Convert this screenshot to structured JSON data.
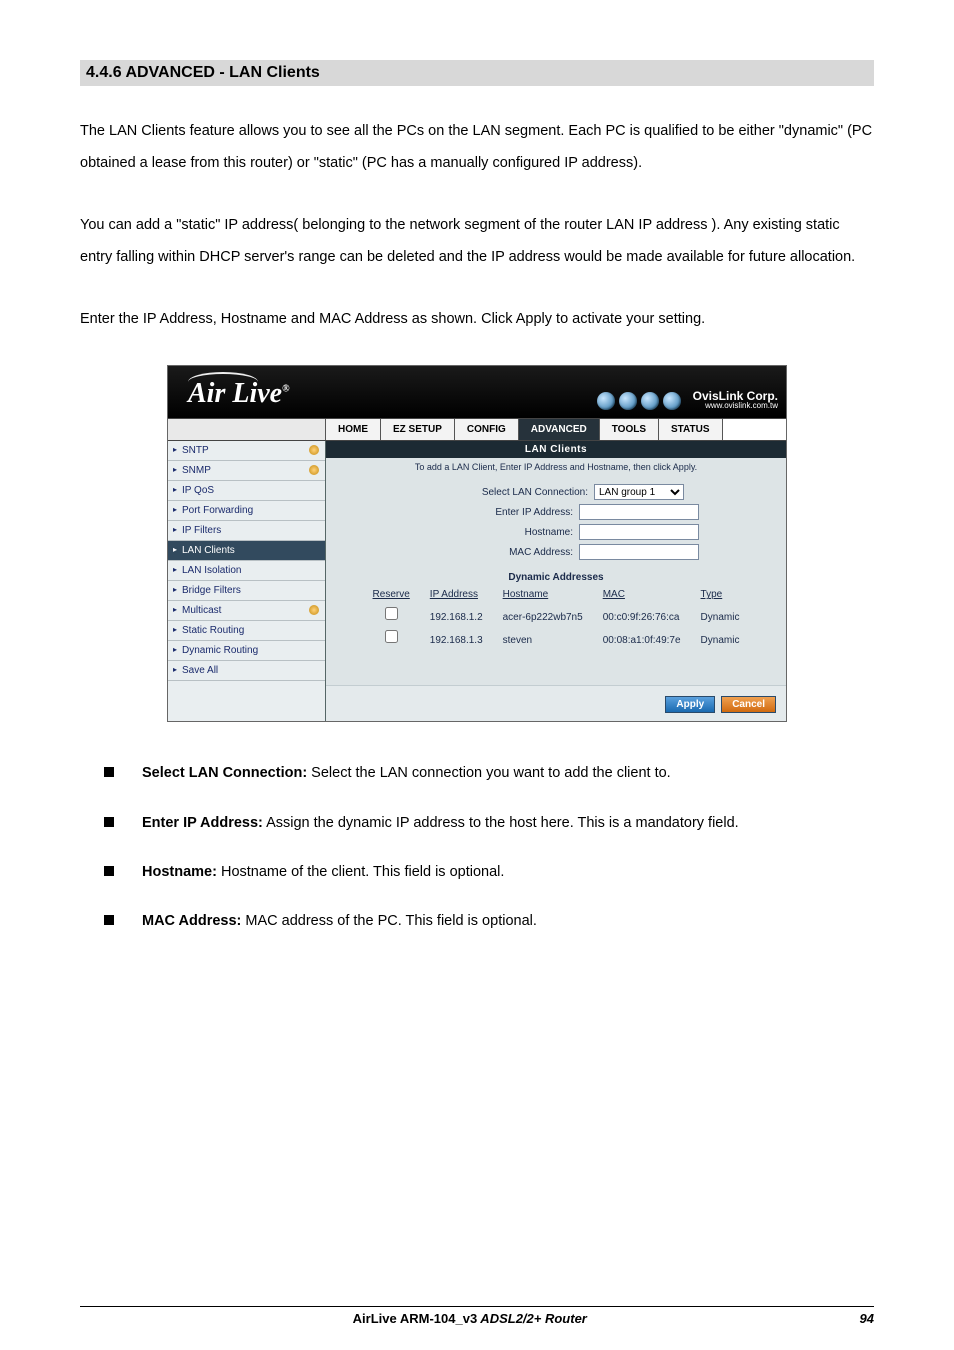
{
  "section_title": "4.4.6 ADVANCED - LAN Clients",
  "para1": "The LAN Clients feature allows you to see all the PCs on the LAN segment. Each PC is qualified to be either \"dynamic\" (PC obtained a lease from this router) or \"static\" (PC has a manually configured IP address).",
  "para2": "You can add a \"static\" IP address( belonging to the network segment of the router LAN IP address ). Any existing static entry falling within DHCP server's range can be deleted and the IP address would be made available for future allocation.",
  "para3": "Enter the IP Address, Hostname and MAC Address as shown. Click Apply to activate your setting.",
  "router": {
    "brand": "Air Live",
    "brand_reg": "®",
    "ovislink": "OvisLink Corp.",
    "ovislink_url": "www.ovislink.com.tw",
    "tabs": [
      "HOME",
      "EZ SETUP",
      "CONFIG",
      "ADVANCED",
      "TOOLS",
      "STATUS"
    ],
    "active_tab": "ADVANCED",
    "sidebar": [
      {
        "label": "SNTP",
        "icon": true
      },
      {
        "label": "SNMP",
        "icon": true
      },
      {
        "label": "IP QoS"
      },
      {
        "label": "Port Forwarding"
      },
      {
        "label": "IP Filters"
      },
      {
        "label": "LAN Clients",
        "active": true
      },
      {
        "label": "LAN Isolation"
      },
      {
        "label": "Bridge Filters"
      },
      {
        "label": "Multicast",
        "icon": true
      },
      {
        "label": "Static Routing"
      },
      {
        "label": "Dynamic Routing"
      },
      {
        "label": "Save All"
      }
    ],
    "panel": {
      "title": "LAN Clients",
      "subtitle": "To add a LAN Client, Enter IP Address and Hostname, then click Apply.",
      "fields": {
        "select_label": "Select LAN Connection:",
        "select_value": "LAN group 1",
        "ip_label": "Enter IP Address:",
        "ip_value": "",
        "host_label": "Hostname:",
        "host_value": "",
        "mac_label": "MAC Address:",
        "mac_value": ""
      },
      "dyn_title": "Dynamic Addresses",
      "dyn_headers": [
        "Reserve",
        "IP Address",
        "Hostname",
        "MAC",
        "Type"
      ],
      "dyn_rows": [
        {
          "reserve": false,
          "ip": "192.168.1.2",
          "host": "acer-6p222wb7n5",
          "mac": "00:c0:9f:26:76:ca",
          "type": "Dynamic"
        },
        {
          "reserve": false,
          "ip": "192.168.1.3",
          "host": "steven",
          "mac": "00:08:a1:0f:49:7e",
          "type": "Dynamic"
        }
      ],
      "apply": "Apply",
      "cancel": "Cancel"
    }
  },
  "bullets": [
    {
      "bold": "Select LAN Connection:",
      "rest": " Select the LAN connection you want to add the client to."
    },
    {
      "bold": "Enter IP Address:",
      "rest": " Assign the dynamic IP address to the host here. This is a mandatory field."
    },
    {
      "bold": "Hostname:",
      "rest": " Hostname of the client. This field is optional."
    },
    {
      "bold": "MAC Address:",
      "rest": " MAC address of the PC. This field is optional."
    }
  ],
  "footer": {
    "product_bold": "AirLive ARM-104_v3",
    "product_ital": " ADSL2/2+ Router",
    "page": "94"
  }
}
